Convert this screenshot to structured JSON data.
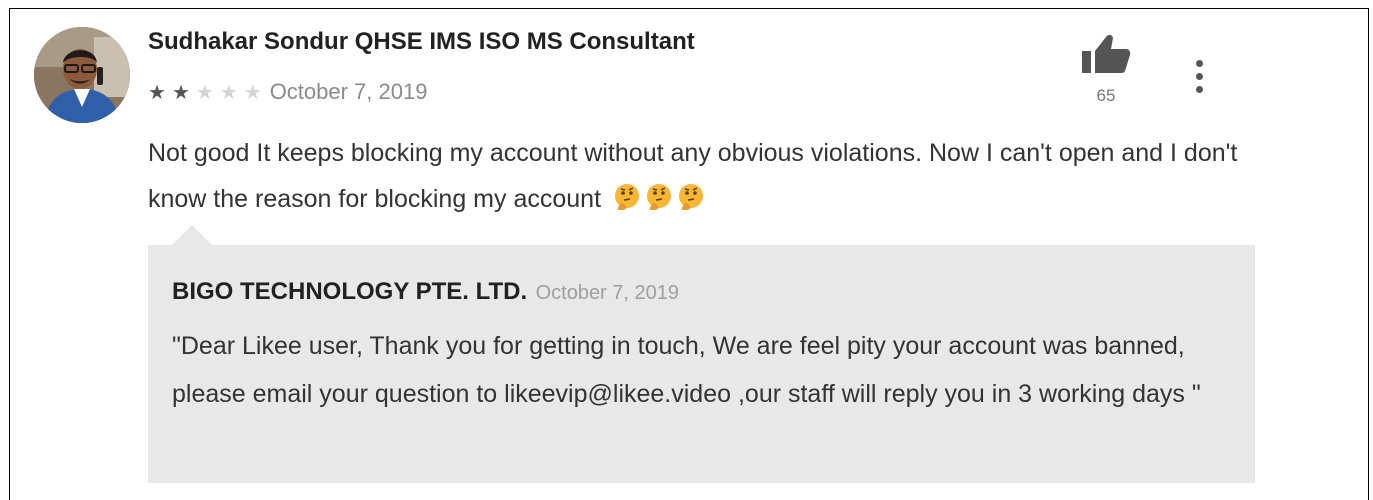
{
  "review": {
    "author": "Sudhakar Sondur QHSE IMS ISO MS Consultant",
    "rating": 2,
    "max_rating": 5,
    "stars": [
      "★",
      "★",
      "★",
      "★",
      "★"
    ],
    "date": "October 7, 2019",
    "helpful_count": "65",
    "text": "Not good It keeps blocking my account without any obvious violations. Now I can't open and I don't know the reason for blocking my account",
    "emoji": [
      "thinking-face",
      "thinking-face",
      "thinking-face"
    ]
  },
  "reply": {
    "author": "BIGO TECHNOLOGY PTE. LTD.",
    "date": "October 7, 2019",
    "text": "\"Dear Likee user, Thank you for getting in touch, We are feel pity your account was banned, please email your question to likeevip@likee.video ,our staff will reply you in 3 working days \""
  },
  "icons": {
    "helpful": "thumbs-up-icon",
    "menu": "more-vertical-icon",
    "avatar": "user-avatar"
  },
  "colors": {
    "star_filled": "#555555",
    "star_empty": "#d4d4d4",
    "reply_background": "#e8e8e8",
    "icon": "#555555"
  }
}
